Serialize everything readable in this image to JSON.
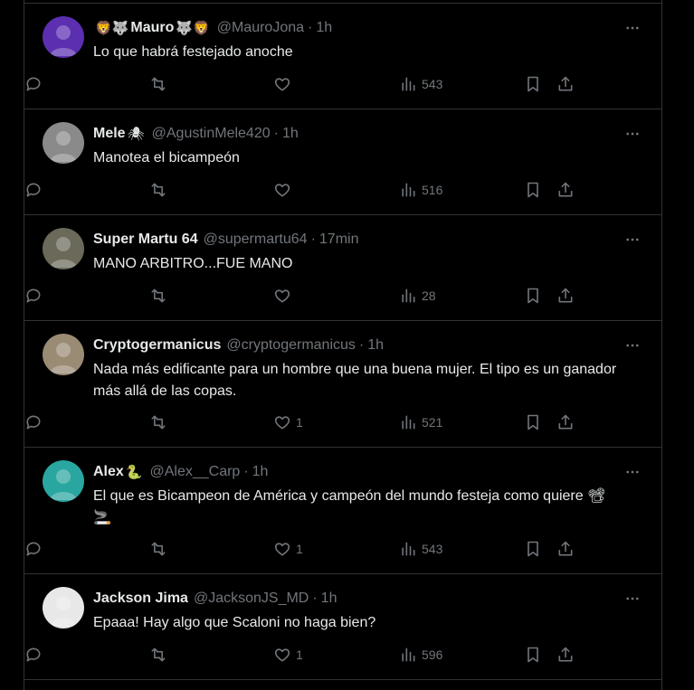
{
  "tweets": [
    {
      "display_name": "Mauro",
      "name_emoji_before": "🦁🐺",
      "name_emoji_after": "🐺🦁",
      "handle": "@MauroJona",
      "time": "1h",
      "text": "Lo que habrá festejado anoche",
      "reply_count": "",
      "retweet_count": "",
      "like_count": "",
      "view_count": "543",
      "avatar_color": "#5b2fb0"
    },
    {
      "display_name": "Mele",
      "name_emoji_before": "",
      "name_emoji_after": "🕷",
      "handle": "@AgustinMele420",
      "time": "1h",
      "text": "Manotea el bicampeón",
      "reply_count": "",
      "retweet_count": "",
      "like_count": "",
      "view_count": "516",
      "avatar_color": "#8a8a8a"
    },
    {
      "display_name": "Super Martu 64",
      "name_emoji_before": "",
      "name_emoji_after": "",
      "handle": "@supermartu64",
      "time": "17min",
      "text": "MANO ARBITRO...FUE MANO",
      "reply_count": "",
      "retweet_count": "",
      "like_count": "",
      "view_count": "28",
      "avatar_color": "#6b6a5a"
    },
    {
      "display_name": "Cryptogermanicus",
      "name_emoji_before": "",
      "name_emoji_after": "",
      "handle": "@cryptogermanicus",
      "time": "1h",
      "text": "Nada más edificante para un hombre que una buena mujer. El tipo es un ganador más allá de las copas.",
      "reply_count": "",
      "retweet_count": "",
      "like_count": "1",
      "view_count": "521",
      "avatar_color": "#9a8b74"
    },
    {
      "display_name": "Alex",
      "name_emoji_before": "",
      "name_emoji_after": "🐍",
      "handle": "@Alex__Carp",
      "time": "1h",
      "text": "El que es Bicampeon de América y campeón del mundo festeja como quiere 📽 🚬",
      "reply_count": "",
      "retweet_count": "",
      "like_count": "1",
      "view_count": "543",
      "avatar_color": "#2aa6a0"
    },
    {
      "display_name": "Jackson Jima",
      "name_emoji_before": "",
      "name_emoji_after": "",
      "handle": "@JacksonJS_MD",
      "time": "1h",
      "text": "Epaaa! Hay algo que Scaloni no haga bien?",
      "reply_count": "",
      "retweet_count": "",
      "like_count": "1",
      "view_count": "596",
      "avatar_color": "#e8e8e8"
    }
  ],
  "icons": {
    "more": "more-horizontal-icon",
    "reply": "reply-icon",
    "retweet": "retweet-icon",
    "like": "heart-icon",
    "views": "views-chart-icon",
    "bookmark": "bookmark-icon",
    "share": "share-icon"
  },
  "colors": {
    "background": "#000000",
    "border": "#2f3336",
    "text_primary": "#e7e9ea",
    "text_secondary": "#71767b"
  }
}
